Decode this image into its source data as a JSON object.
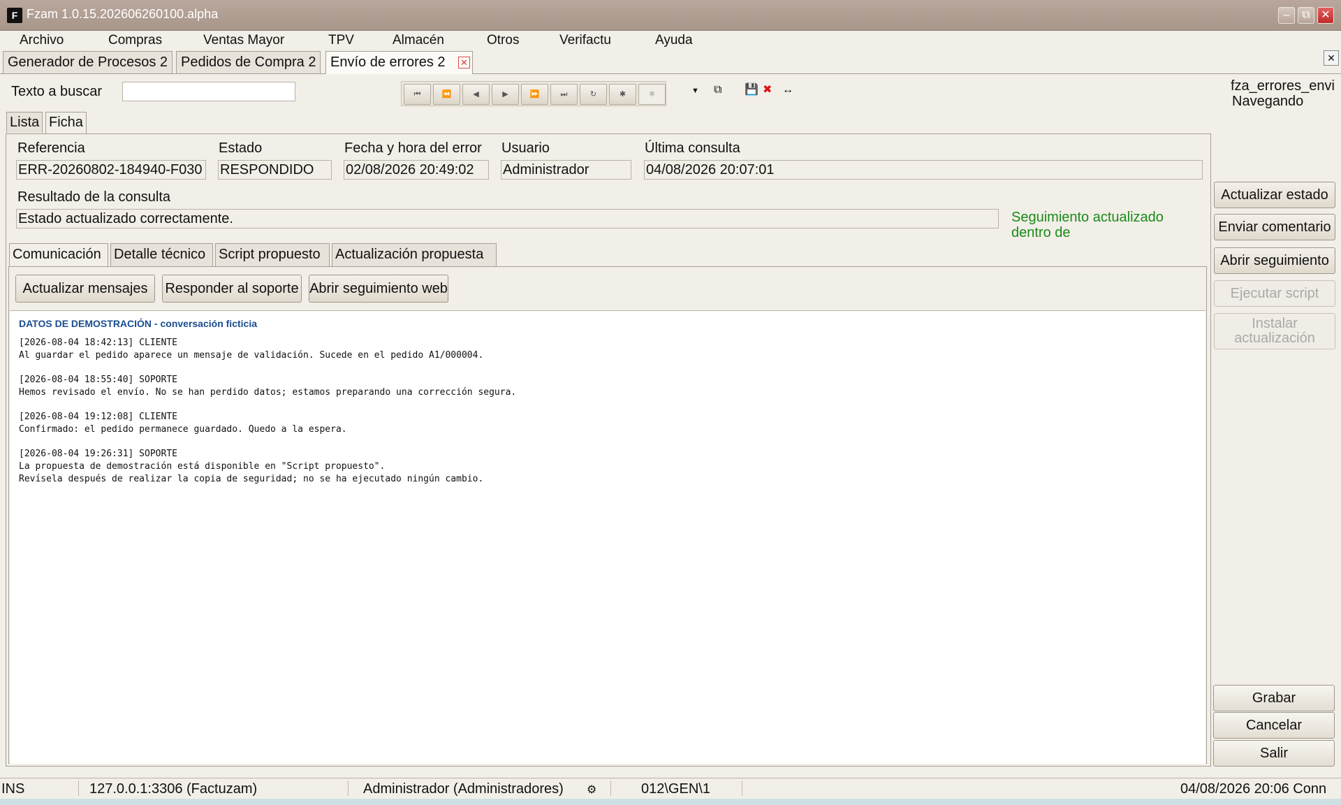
{
  "window": {
    "icon_text": "F",
    "title": "Fzam 1.0.15.202606260100.alpha"
  },
  "menu": [
    "Archivo",
    "Compras",
    "Ventas Mayor",
    "TPV",
    "Almacén",
    "Otros",
    "Verifactu",
    "Ayuda"
  ],
  "doc_tabs": [
    "Generador de Procesos 2",
    "Pedidos de Compra 2",
    "Envío de errores 2"
  ],
  "search": {
    "label": "Texto a buscar",
    "value": ""
  },
  "module": {
    "name": "fza_errores_envi",
    "state": "Navegando"
  },
  "view_tabs": [
    "Lista",
    "Ficha"
  ],
  "form": {
    "ref_label": "Referencia",
    "ref_value": "ERR-20260802-184940-F030",
    "estado_label": "Estado",
    "estado_value": "RESPONDIDO",
    "fecha_label": "Fecha y hora del error",
    "fecha_value": "02/08/2026 20:49:02",
    "usuario_label": "Usuario",
    "usuario_value": "Administrador",
    "ultima_label": "Última consulta",
    "ultima_value": "04/08/2026 20:07:01",
    "resultado_label": "Resultado de la consulta",
    "resultado_value": "Estado actualizado correctamente.",
    "tracking_note": "Seguimiento actualizado dentro de"
  },
  "content_tabs": [
    "Comunicación",
    "Detalle técnico",
    "Script propuesto",
    "Actualización propuesta"
  ],
  "actions": [
    "Actualizar mensajes",
    "Responder al soporte",
    "Abrir seguimiento web"
  ],
  "messages": {
    "heading": "DATOS DE DEMOSTRACIÓN - conversación ficticia",
    "items": [
      {
        "header": "[2026-08-04 18:42:13] CLIENTE",
        "body": "Al guardar el pedido aparece un mensaje de validación. Sucede en el pedido A1/000004."
      },
      {
        "header": "[2026-08-04 18:55:40] SOPORTE",
        "body": "Hemos revisado el envío. No se han perdido datos; estamos preparando una corrección segura."
      },
      {
        "header": "[2026-08-04 19:12:08] CLIENTE",
        "body": "Confirmado: el pedido permanece guardado. Quedo a la espera."
      },
      {
        "header": "[2026-08-04 19:26:31] SOPORTE",
        "body": "La propuesta de demostración está disponible en \"Script propuesto\".\nRevísela después de realizar la copia de seguridad; no se ha ejecutado ningún cambio."
      }
    ]
  },
  "side_buttons": {
    "actualizar_estado": "Actualizar estado",
    "enviar_comentario": "Enviar comentario",
    "abrir_seguimiento": "Abrir seguimiento",
    "ejecutar_script": "Ejecutar script",
    "instalar_actualizacion": "Instalar actualización"
  },
  "bottom_buttons": [
    "Grabar",
    "Cancelar",
    "Salir"
  ],
  "status": {
    "mode": "INS",
    "connection": "127.0.0.1:3306 (Factuzam)",
    "user": "Administrador (Administradores)",
    "path": "012\\GEN\\1",
    "datetime": "04/08/2026 20:06 Conn"
  }
}
